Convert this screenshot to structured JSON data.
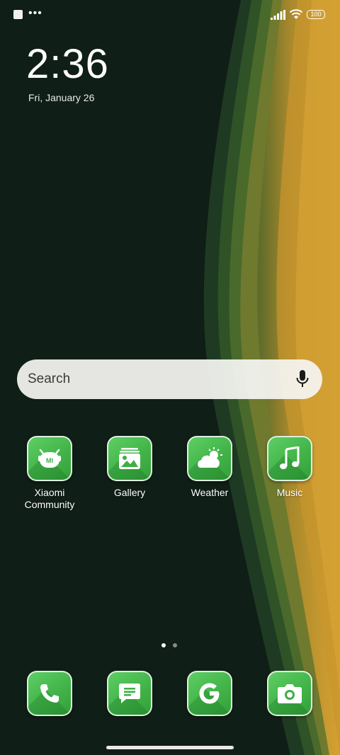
{
  "status_bar": {
    "battery_level": "100",
    "icons": [
      "notification-square-icon",
      "more-dots-icon",
      "signal-icon",
      "wifi-icon",
      "battery-icon"
    ]
  },
  "clock": {
    "time": "2:36",
    "date": "Fri, January 26"
  },
  "search": {
    "placeholder": "Search",
    "mic_icon": "microphone-icon"
  },
  "apps": [
    {
      "label": "Xiaomi Community",
      "icon": "xiaomi-community-icon"
    },
    {
      "label": "Gallery",
      "icon": "gallery-icon"
    },
    {
      "label": "Weather",
      "icon": "weather-icon"
    },
    {
      "label": "Music",
      "icon": "music-icon"
    }
  ],
  "dock": [
    {
      "icon": "phone-icon"
    },
    {
      "icon": "messages-icon"
    },
    {
      "icon": "google-icon"
    },
    {
      "icon": "camera-icon"
    }
  ],
  "page_indicator": {
    "pages": 2,
    "current": 1
  },
  "colors": {
    "wallpaper_dark": "#0f1e16",
    "wallpaper_gold": "#c99a2c",
    "icon_green": "#44b64b",
    "dot_active": "#ffffff",
    "dot_inactive": "#8a8a8a"
  }
}
